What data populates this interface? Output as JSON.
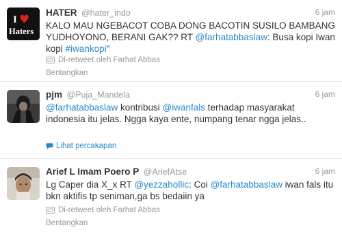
{
  "tweets": [
    {
      "fullname": "HATER",
      "screenname": "@hater_indo",
      "time": "6 jam",
      "avatar_text": [
        "I",
        "♥",
        "Haters"
      ],
      "text_1": "KALO MAU NGEBACOT COBA DONG BACOTIN SUSILO BAMBANG YUDHOYONO, BERANI GAK?? RT ",
      "mention": "@farhatabbaslaw",
      "text_2": ": Busa kopi Iwan kopi ",
      "hashtag": "#iwankopi",
      "text_3": "\"",
      "retweeted_by": "Di-retweet oleh Farhat Abbas",
      "action": "Bentangkan"
    },
    {
      "fullname": "pjm",
      "screenname": "@Puja_Mandela",
      "time": "6 jam",
      "mention_1": "@farhatabbaslaw",
      "text_1": " kontribusi ",
      "mention_2": "@iwanfals",
      "text_2": " terhadap masyarakat indonesia itu jelas. Ngga kaya ente, numpang tenar ngga jelas..",
      "action": "Lihat percakapan"
    },
    {
      "fullname": "Arief L Imam Poero P",
      "screenname": "@AriefAtse",
      "time": "6 jam",
      "text_1": "Lg Caper dia X_x RT ",
      "mention_1": "@yezzahollic",
      "text_2": ": Coi ",
      "mention_2": "@farhatabbaslaw",
      "text_3": " iwan fals itu bkn aktifis tp seniman,ga bs bedaiin ya",
      "retweeted_by": "Di-retweet oleh Farhat Abbas",
      "action": "Bentangkan"
    }
  ],
  "colors": {
    "link": "#2a87c8",
    "muted": "#999999",
    "text": "#333333",
    "heart": "#e0201b"
  },
  "icons": {
    "retweet": "retweet-icon",
    "conversation": "conversation-bubble-icon"
  }
}
